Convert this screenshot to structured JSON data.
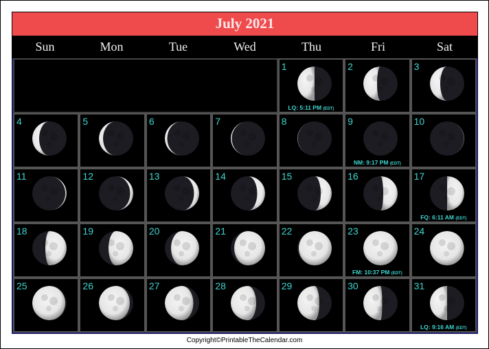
{
  "title": "July 2021",
  "weekdays": [
    "Sun",
    "Mon",
    "Tue",
    "Wed",
    "Thu",
    "Fri",
    "Sat"
  ],
  "first_weekday_index": 4,
  "days": [
    {
      "day": "1",
      "illum": 0.5,
      "waxing": false,
      "event": "LQ: 5:11 PM",
      "tz": "(EDT)"
    },
    {
      "day": "2",
      "illum": 0.4,
      "waxing": false
    },
    {
      "day": "3",
      "illum": 0.3,
      "waxing": false
    },
    {
      "day": "4",
      "illum": 0.2,
      "waxing": false
    },
    {
      "day": "5",
      "illum": 0.12,
      "waxing": false
    },
    {
      "day": "6",
      "illum": 0.07,
      "waxing": false
    },
    {
      "day": "7",
      "illum": 0.03,
      "waxing": false
    },
    {
      "day": "8",
      "illum": 0.01,
      "waxing": false
    },
    {
      "day": "9",
      "illum": 0.0,
      "waxing": true,
      "event": "NM: 9:17 PM",
      "tz": "(EDT)"
    },
    {
      "day": "10",
      "illum": 0.01,
      "waxing": true
    },
    {
      "day": "11",
      "illum": 0.04,
      "waxing": true
    },
    {
      "day": "12",
      "illum": 0.09,
      "waxing": true
    },
    {
      "day": "13",
      "illum": 0.15,
      "waxing": true
    },
    {
      "day": "14",
      "illum": 0.23,
      "waxing": true
    },
    {
      "day": "15",
      "illum": 0.32,
      "waxing": true
    },
    {
      "day": "16",
      "illum": 0.42,
      "waxing": true
    },
    {
      "day": "17",
      "illum": 0.5,
      "waxing": true,
      "event": "FQ: 6:11 AM",
      "tz": "(EDT)"
    },
    {
      "day": "18",
      "illum": 0.62,
      "waxing": true
    },
    {
      "day": "19",
      "illum": 0.72,
      "waxing": true
    },
    {
      "day": "20",
      "illum": 0.82,
      "waxing": true
    },
    {
      "day": "21",
      "illum": 0.9,
      "waxing": true
    },
    {
      "day": "22",
      "illum": 0.96,
      "waxing": true
    },
    {
      "day": "23",
      "illum": 1.0,
      "waxing": true,
      "event": "FM: 10:37 PM",
      "tz": "(EDT)"
    },
    {
      "day": "24",
      "illum": 0.99,
      "waxing": false
    },
    {
      "day": "25",
      "illum": 0.96,
      "waxing": false
    },
    {
      "day": "26",
      "illum": 0.9,
      "waxing": false
    },
    {
      "day": "27",
      "illum": 0.83,
      "waxing": false
    },
    {
      "day": "28",
      "illum": 0.74,
      "waxing": false
    },
    {
      "day": "29",
      "illum": 0.64,
      "waxing": false
    },
    {
      "day": "30",
      "illum": 0.55,
      "waxing": false
    },
    {
      "day": "31",
      "illum": 0.5,
      "waxing": false,
      "event": "LQ: 9:16 AM",
      "tz": "(EDT)"
    }
  ],
  "colors": {
    "title_bg": "#ef4a4c",
    "day_number": "#3fd6d0",
    "moon_lit": "#e6e6e6",
    "moon_dark": "#1c1c22"
  },
  "footer": "Copyright©PrintableTheCalendar.com"
}
